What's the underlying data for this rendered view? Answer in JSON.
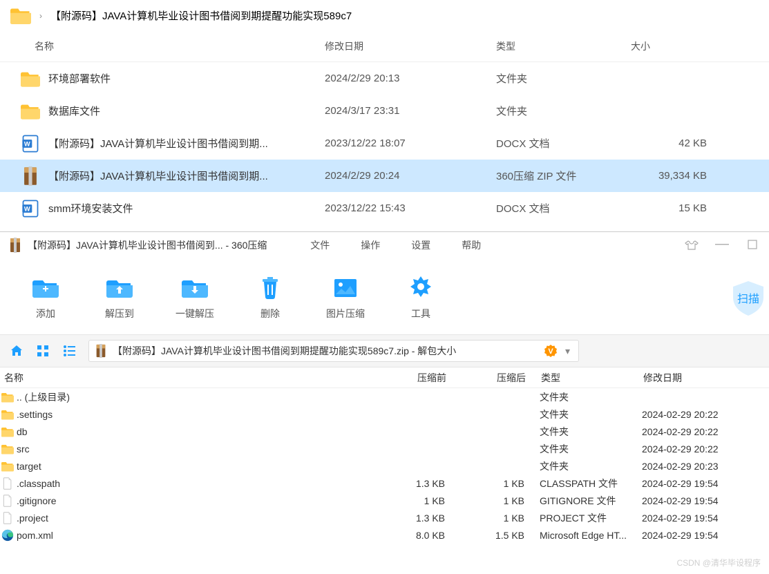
{
  "explorer": {
    "breadcrumb": "【附源码】JAVA计算机毕业设计图书借阅到期提醒功能实现589c7",
    "columns": {
      "name": "名称",
      "date": "修改日期",
      "type": "类型",
      "size": "大小"
    },
    "rows": [
      {
        "icon": "folder",
        "name": "环境部署软件",
        "date": "2024/2/29 20:13",
        "type": "文件夹",
        "size": "",
        "color": "#ffc233"
      },
      {
        "icon": "folder",
        "name": "数据库文件",
        "date": "2024/3/17 23:31",
        "type": "文件夹",
        "size": "",
        "color": "#ffc233"
      },
      {
        "icon": "docx",
        "name": "【附源码】JAVA计算机毕业设计图书借阅到期...",
        "date": "2023/12/22 18:07",
        "type": "DOCX 文档",
        "size": "42 KB",
        "color": "#2b7cd3"
      },
      {
        "icon": "zip",
        "name": "【附源码】JAVA计算机毕业设计图书借阅到期...",
        "date": "2024/2/29 20:24",
        "type": "360压缩 ZIP 文件",
        "size": "39,334 KB",
        "color": "#ff4d4d",
        "selected": true
      },
      {
        "icon": "docx",
        "name": "smm环境安装文件",
        "date": "2023/12/22 15:43",
        "type": "DOCX 文档",
        "size": "15 KB",
        "color": "#2b7cd3"
      }
    ]
  },
  "zip": {
    "title": "【附源码】JAVA计算机毕业设计图书借阅到... - 360压缩",
    "menu": [
      "文件",
      "操作",
      "设置",
      "帮助"
    ],
    "toolbar": [
      {
        "name": "add",
        "label": "添加"
      },
      {
        "name": "extract-to",
        "label": "解压到"
      },
      {
        "name": "one-click-extract",
        "label": "一键解压"
      },
      {
        "name": "delete",
        "label": "删除"
      },
      {
        "name": "image-compress",
        "label": "图片压缩"
      },
      {
        "name": "tools",
        "label": "工具"
      }
    ],
    "scan_label": "扫描",
    "path": "【附源码】JAVA计算机毕业设计图书借阅到期提醒功能实现589c7.zip - 解包大小",
    "columns": {
      "name": "名称",
      "before": "压缩前",
      "after": "压缩后",
      "type": "类型",
      "date": "修改日期"
    },
    "rows": [
      {
        "icon": "folder",
        "name": ".. (上级目录)",
        "before": "",
        "after": "",
        "type": "文件夹",
        "date": ""
      },
      {
        "icon": "folder",
        "name": ".settings",
        "before": "",
        "after": "",
        "type": "文件夹",
        "date": "2024-02-29 20:22"
      },
      {
        "icon": "folder",
        "name": "db",
        "before": "",
        "after": "",
        "type": "文件夹",
        "date": "2024-02-29 20:22"
      },
      {
        "icon": "folder",
        "name": "src",
        "before": "",
        "after": "",
        "type": "文件夹",
        "date": "2024-02-29 20:22"
      },
      {
        "icon": "folder",
        "name": "target",
        "before": "",
        "after": "",
        "type": "文件夹",
        "date": "2024-02-29 20:23"
      },
      {
        "icon": "file",
        "name": ".classpath",
        "before": "1.3 KB",
        "after": "1 KB",
        "type": "CLASSPATH 文件",
        "date": "2024-02-29 19:54"
      },
      {
        "icon": "file",
        "name": ".gitignore",
        "before": "1 KB",
        "after": "1 KB",
        "type": "GITIGNORE 文件",
        "date": "2024-02-29 19:54"
      },
      {
        "icon": "file",
        "name": ".project",
        "before": "1.3 KB",
        "after": "1 KB",
        "type": "PROJECT 文件",
        "date": "2024-02-29 19:54"
      },
      {
        "icon": "edge",
        "name": "pom.xml",
        "before": "8.0 KB",
        "after": "1.5 KB",
        "type": "Microsoft Edge HT...",
        "date": "2024-02-29 19:54"
      }
    ]
  },
  "watermark": "CSDN @清华毕设程序"
}
